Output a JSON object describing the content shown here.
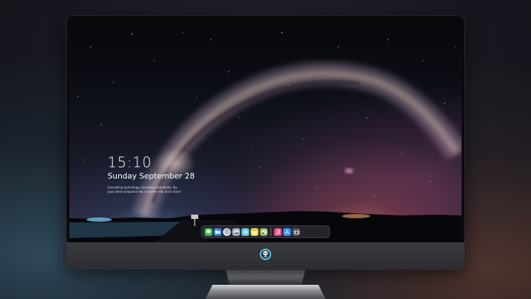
{
  "lock_screen": {
    "time": "15:10",
    "date": "Sunday September 28",
    "slogan_line_1": "Innovating technology, Ensuring productivity, Nu..",
    "slogan_line_2": "your ideal companion for a smarter life, Since Since"
  },
  "dock": {
    "apps": [
      {
        "name": "messages-icon",
        "color": "#3cc34f"
      },
      {
        "name": "files-icon",
        "color": "#2f7fe0"
      },
      {
        "name": "compass-icon",
        "color": "#e9e9ee"
      },
      {
        "name": "gallery-icon",
        "color": "#9aa7b3"
      },
      {
        "name": "robot-icon",
        "color": "#58c8e8"
      },
      {
        "name": "notes-icon",
        "color": "#f4d34a"
      },
      {
        "name": "photos-icon",
        "color": "#7fb24f"
      },
      {
        "name": "music-icon",
        "color": "#ea4c89"
      },
      {
        "name": "app-store-icon",
        "color": "#3a8ff0"
      },
      {
        "name": "camera-icon",
        "color": "#55575e"
      }
    ]
  },
  "colors": {
    "bezel": "#0b0b0d",
    "chin": "#34353a",
    "stand_base": "#b5b7bb"
  }
}
